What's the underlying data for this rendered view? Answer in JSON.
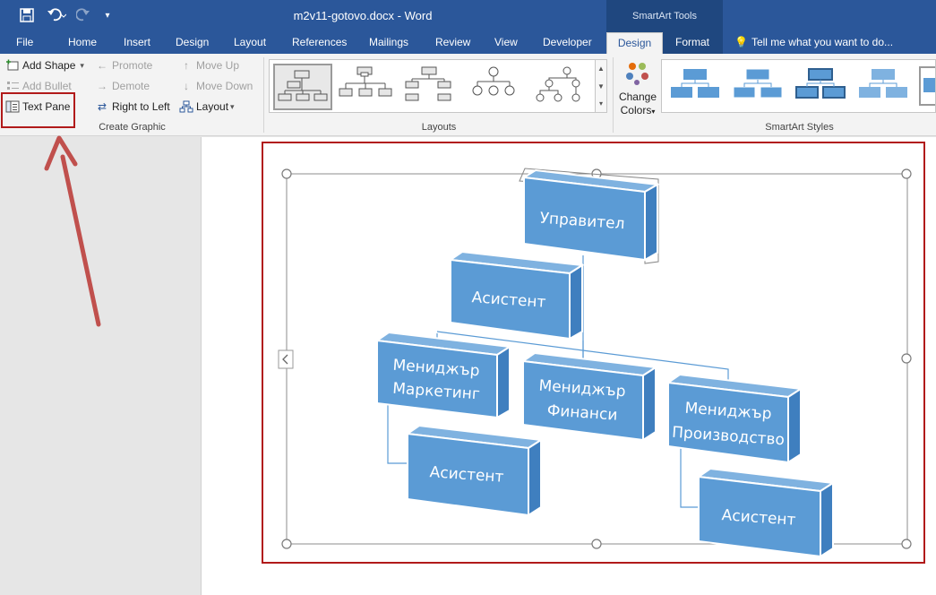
{
  "window": {
    "title": "m2v11-gotovo.docx - Word",
    "contextual_group": "SmartArt Tools"
  },
  "qat": {
    "save_icon": "save-icon",
    "undo_icon": "undo-icon",
    "redo_icon": "redo-icon",
    "customize_icon": "customize-qat-icon"
  },
  "tabs": [
    {
      "label": "File"
    },
    {
      "label": "Home"
    },
    {
      "label": "Insert"
    },
    {
      "label": "Design"
    },
    {
      "label": "Layout"
    },
    {
      "label": "References"
    },
    {
      "label": "Mailings"
    },
    {
      "label": "Review"
    },
    {
      "label": "View"
    },
    {
      "label": "Developer"
    },
    {
      "label": "Design",
      "active": true
    },
    {
      "label": "Format"
    }
  ],
  "tell_me": "Tell me what you want to do...",
  "ribbon": {
    "create_graphic": {
      "label": "Create Graphic",
      "add_shape": "Add Shape",
      "add_bullet": "Add Bullet",
      "text_pane": "Text Pane",
      "promote": "Promote",
      "demote": "Demote",
      "right_to_left": "Right to Left",
      "move_up": "Move Up",
      "move_down": "Move Down",
      "layout": "Layout"
    },
    "layouts": {
      "label": "Layouts"
    },
    "smartart_styles": {
      "label": "SmartArt Styles",
      "change_colors_line1": "Change",
      "change_colors_line2": "Colors"
    }
  },
  "diagram": {
    "manager": "Управител",
    "assistant_top": "Асистент",
    "marketing_line1": "Мениджър",
    "marketing_line2": "Маркетинг",
    "finance_line1": "Мениджър",
    "finance_line2": "Финанси",
    "production_line1": "Мениджър",
    "production_line2": "Производство",
    "assistant_left": "Асистент",
    "assistant_right": "Асистент"
  },
  "colors": {
    "titlebar": "#2b579a",
    "box_front": "#5b9bd5",
    "box_top": "#7fb2e0",
    "box_side": "#3f7fbf",
    "highlight": "#b11a1a",
    "arrow": "#c0504d"
  }
}
